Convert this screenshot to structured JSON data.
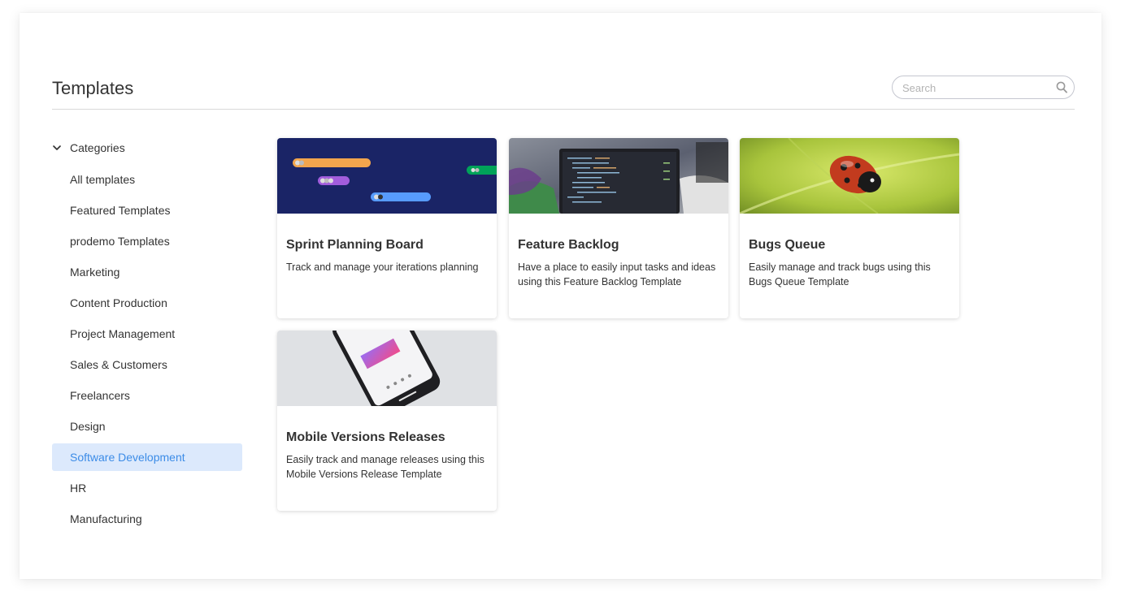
{
  "header": {
    "title": "Templates",
    "search_placeholder": "Search"
  },
  "sidebar": {
    "section_label": "Categories",
    "items": [
      {
        "label": "All templates"
      },
      {
        "label": "Featured Templates"
      },
      {
        "label": "prodemo Templates"
      },
      {
        "label": "Marketing"
      },
      {
        "label": "Content Production"
      },
      {
        "label": "Project Management"
      },
      {
        "label": "Sales & Customers"
      },
      {
        "label": "Freelancers"
      },
      {
        "label": "Design"
      },
      {
        "label": "Software Development",
        "active": true
      },
      {
        "label": "HR"
      },
      {
        "label": "Manufacturing"
      }
    ]
  },
  "cards": [
    {
      "title": "Sprint Planning Board",
      "description": "Track and manage your iterations planning",
      "image": "timeline-board-preview"
    },
    {
      "title": "Feature Backlog",
      "description": "Have a place to easily input tasks and ideas using this Feature Backlog Template",
      "image": "laptop-code-photo"
    },
    {
      "title": "Bugs Queue",
      "description": "Easily manage and track bugs using this Bugs Queue Template",
      "image": "ladybug-photo"
    },
    {
      "title": "Mobile Versions Releases",
      "description": "Easily track and manage releases using this Mobile Versions Release Template",
      "image": "smartphone-photo"
    }
  ],
  "colors": {
    "active_bg": "#dce9fc",
    "active_text": "#3c8ce7",
    "sprint_bg": "#1a2466"
  }
}
